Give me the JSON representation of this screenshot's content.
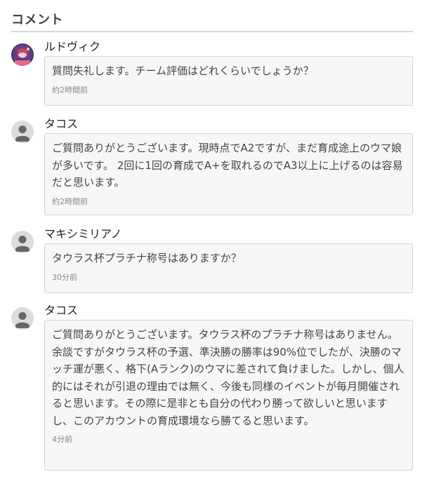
{
  "section": {
    "title": "コメント"
  },
  "comments": [
    {
      "author": "ルドヴィク",
      "avatar": "character-portrait-avatar",
      "text": "質問失礼します。チーム評価はどれくらいでしょうか？",
      "time": "約2時間前"
    },
    {
      "author": "タコス",
      "avatar": "default-user-avatar",
      "text": "ご質問ありがとうございます。現時点でA2ですが、まだ育成途上のウマ娘が多いです。 2回に1回の育成でA+を取れるのでA3以上に上げるのは容易だと思います。",
      "time": "約2時間前"
    },
    {
      "author": "マキシミリアノ",
      "avatar": "default-user-avatar",
      "text": "タウラス杯プラチナ称号はありますか？",
      "time": "30分前"
    },
    {
      "author": "タコス",
      "avatar": "default-user-avatar",
      "text": "ご質問ありがとうございます。タウラス杯のプラチナ称号はありません。余談ですがタウラス杯の予選、準決勝の勝率は90%位でしたが、決勝のマッチ運が悪く、格下(Aランク)のウマに差されて負けました。しかし、個人的にはそれが引退の理由では無く、今後も同様のイベントが毎月開催されると思います。その際に是非とも自分の代わり勝って欲しいと思いますし、このアカウントの育成環境なら勝てると思います。",
      "time": "4分前"
    }
  ]
}
